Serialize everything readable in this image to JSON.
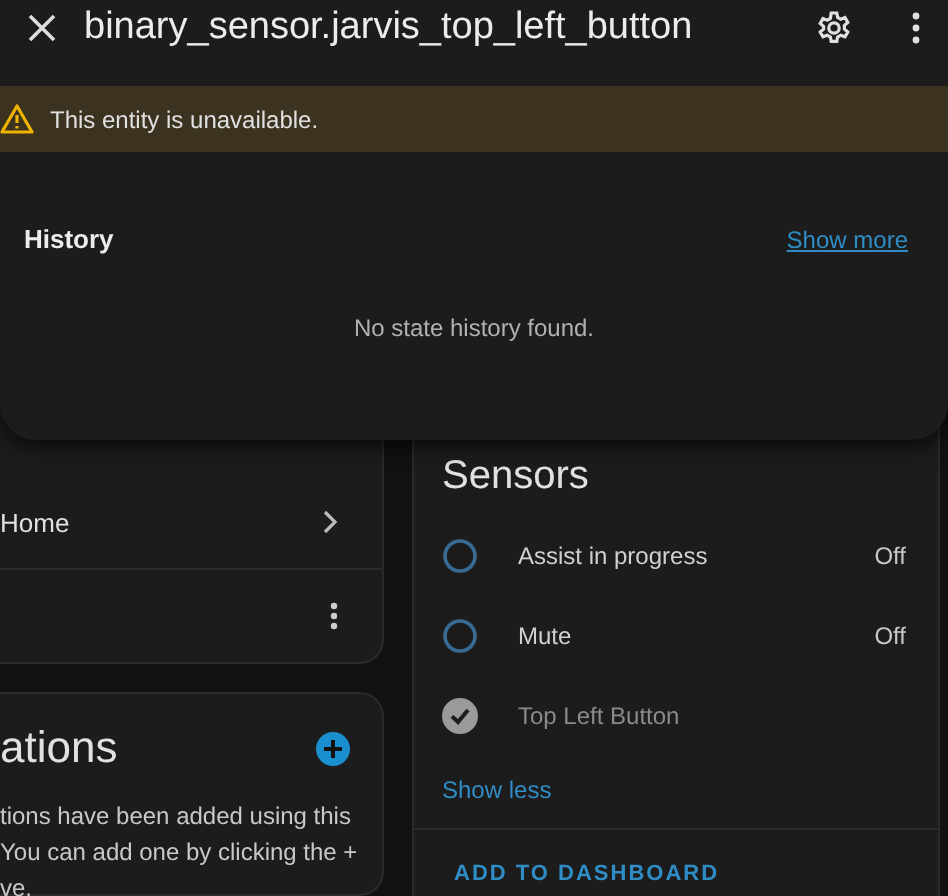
{
  "dialog": {
    "title": "binary_sensor.jarvis_top_left_button",
    "warning": "This entity is unavailable.",
    "history": {
      "heading": "History",
      "link": "Show more",
      "empty": "No state history found."
    }
  },
  "left_card": {
    "row_label": "Home"
  },
  "automations_card": {
    "title": "ations",
    "lines": [
      "tions have been added using this",
      "You can add one by clicking the +",
      "ve."
    ]
  },
  "sensors_card": {
    "title": "Sensors",
    "items": [
      {
        "name": "Assist in progress",
        "state": "Off",
        "unavailable": false
      },
      {
        "name": "Mute",
        "state": "Off",
        "unavailable": false
      },
      {
        "name": "Top Left Button",
        "unavailable": true
      }
    ],
    "toggle": "Show less",
    "action": "ADD TO DASHBOARD"
  }
}
